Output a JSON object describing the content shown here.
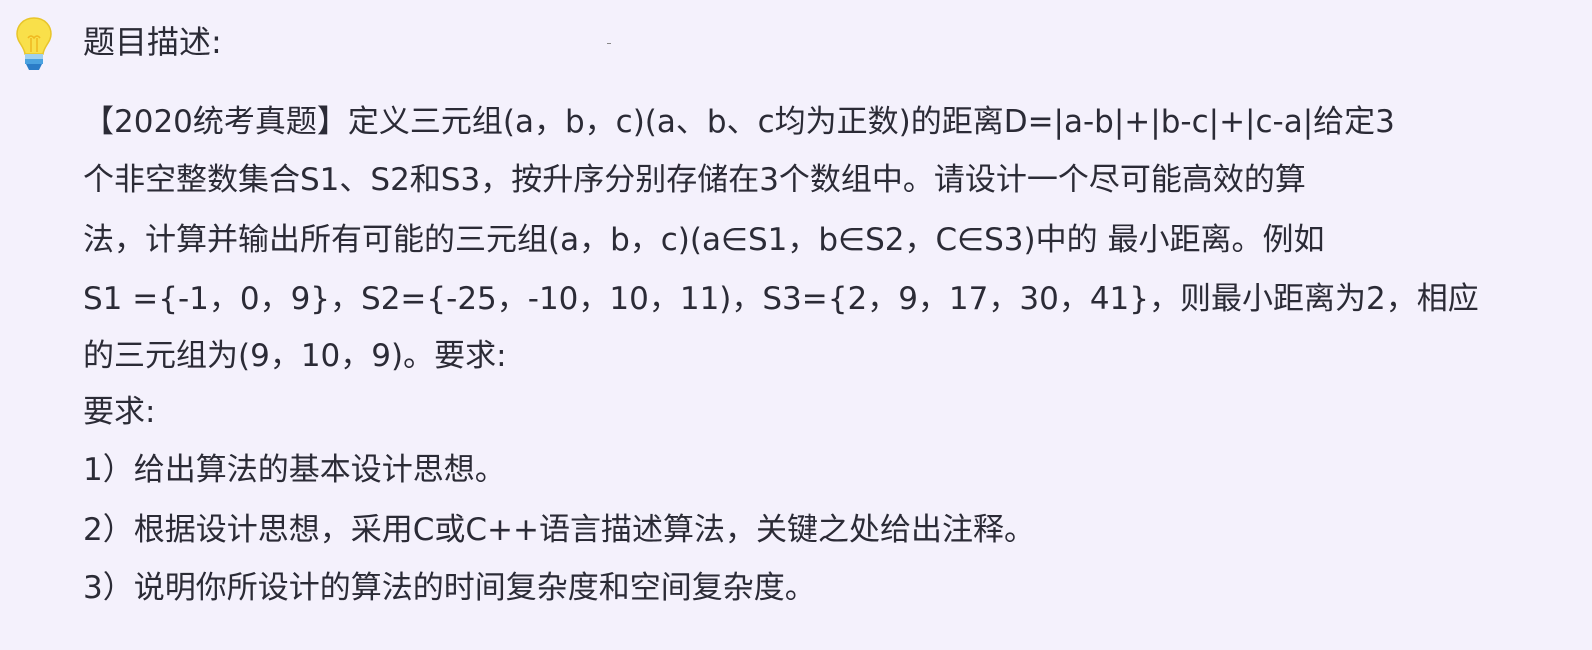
{
  "heading": "题目描述:",
  "icon": "lightbulb-icon",
  "body_lines": [
    "【2020统考真题】定义三元组(a，b，c)(a、b、c均为正数)的距离D=|a-b|+|b-c|+|c-a|给定3",
    "个非空整数集合S1、S2和S3，按升序分别存储在3个数组中。请设计一个尽可能高效的算",
    "法，计算并输出所有可能的三元组(a，b，c)(a∈S1，b∈S2，C∈S3)中的 最小距离。例如",
    "S1 ={-1，0，9}，S2={-25，-10，10，11)，S3={2，9，17，30，41}，则最小距离为2，相应",
    "的三元组为(9，10，9)。要求:",
    "要求:",
    "1）给出算法的基本设计思想。",
    "2）根据设计思想，采用C或C++语言描述算法，关键之处给出注释。",
    "3）说明你所设计的算法的时间复杂度和空间复杂度。"
  ]
}
